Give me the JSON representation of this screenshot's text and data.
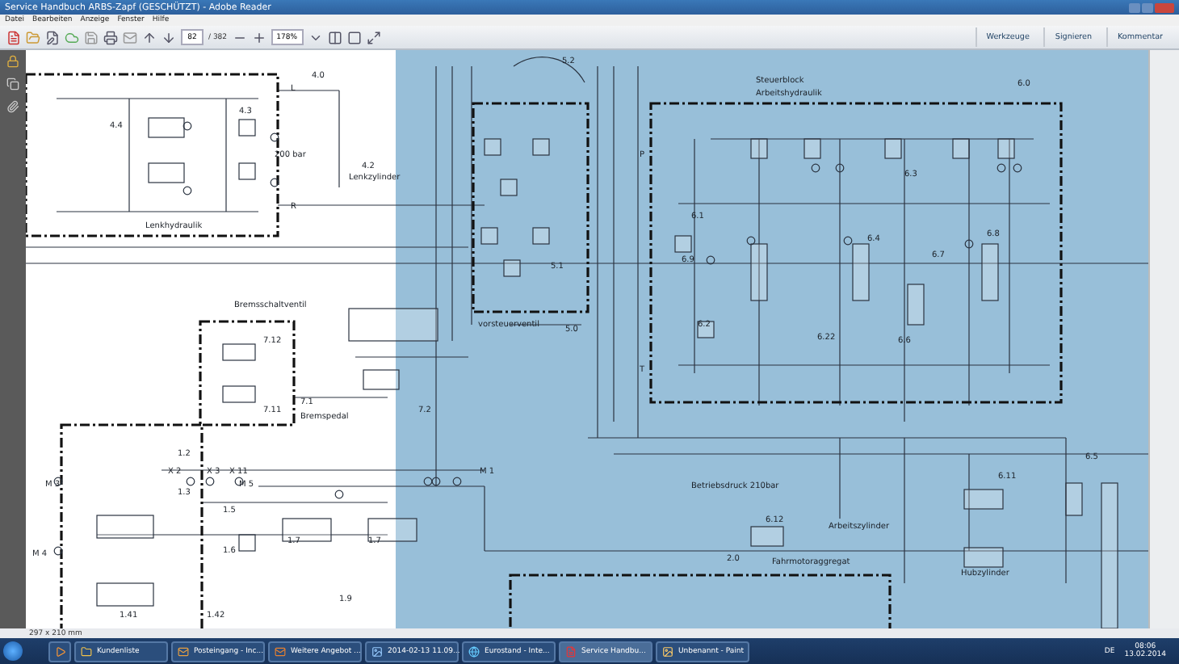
{
  "window": {
    "title": "Service Handbuch ARBS-Zapf (GESCHÜTZT) - Adobe Reader"
  },
  "menu": [
    "Datei",
    "Bearbeiten",
    "Anzeige",
    "Fenster",
    "Hilfe"
  ],
  "toolbar": {
    "page": "82",
    "page_count": "/ 382",
    "zoom": "178%",
    "panels": [
      "Werkzeuge",
      "Signieren",
      "Kommentar"
    ]
  },
  "schematic": {
    "labels": [
      "4.0",
      "4.4",
      "4.3",
      "200 bar",
      "4.2",
      "Lenkzylinder",
      "Lenkhydraulik",
      "L",
      "R",
      "5.2",
      "5.1",
      "vorsteuerventil",
      "5.0",
      "Steuerblock",
      "Arbeitshydraulik",
      "6.0",
      "6.3",
      "6.1",
      "6.9",
      "6.4",
      "6.7",
      "6.8",
      "6.2",
      "6.22",
      "6.6",
      "6.5",
      "6.11",
      "6.12",
      "Arbeitszylinder",
      "Betriebsdruck 210bar",
      "Hubzylinder",
      "2.0",
      "Fahrmotoraggregat",
      "Bremsschaltventil",
      "7.12",
      "7.11",
      "7.1",
      "Bremspedal",
      "7.2",
      "1.2",
      "1.3",
      "1.5",
      "1.6",
      "1.7",
      "1.7",
      "X 2",
      "X 3",
      "X 11",
      "M 1",
      "M 3",
      "M 5",
      "M 4",
      "1.41",
      "1.42",
      "1.9",
      "T",
      "P"
    ]
  },
  "status": {
    "page_size": "297 x 210 mm"
  },
  "taskbar": {
    "items": [
      "Kundenliste",
      "Posteingang - Inc...",
      "Weitere Angebot ...",
      "2014-02-13 11.09...",
      "Eurostand - Inte...",
      "Service Handbu...",
      "Unbenannt - Paint"
    ],
    "language": "DE",
    "time": "08:06",
    "date": "13.02.2014"
  }
}
